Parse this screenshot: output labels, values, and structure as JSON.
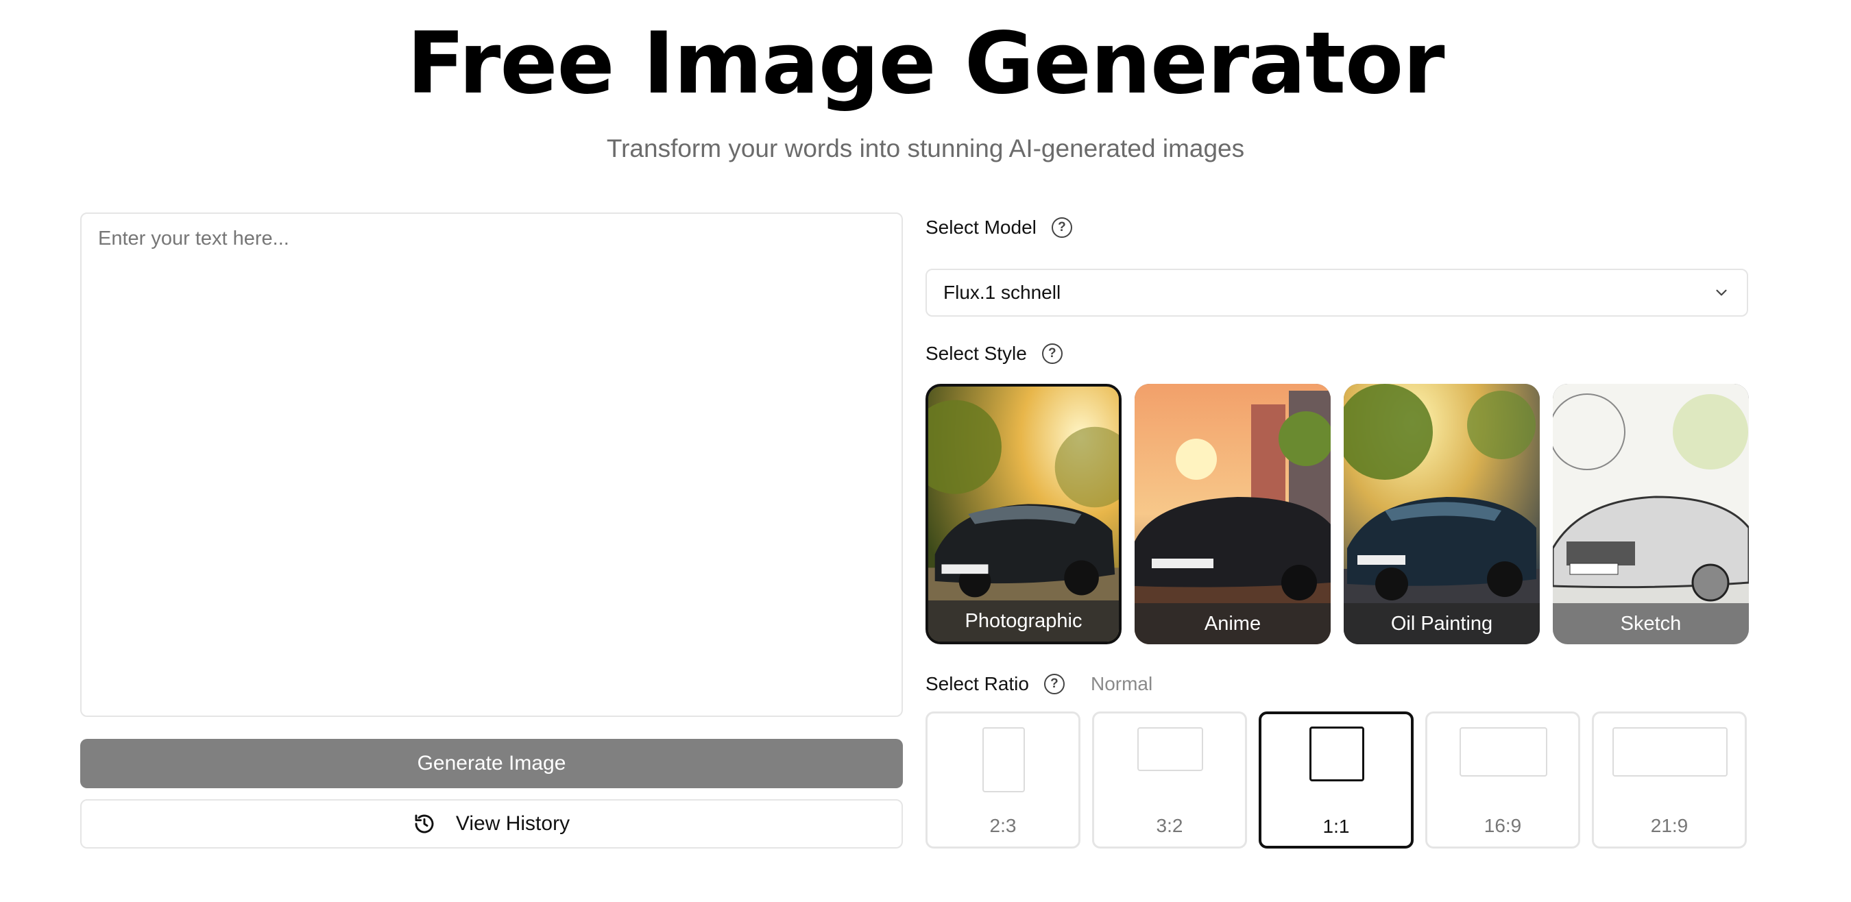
{
  "header": {
    "title": "Free Image Generator",
    "subtitle": "Transform your words into stunning AI-generated images"
  },
  "prompt": {
    "placeholder": "Enter your text here...",
    "value": ""
  },
  "buttons": {
    "generate_label": "Generate Image",
    "history_label": "View History",
    "history_icon": "history-icon"
  },
  "model": {
    "label": "Select Model",
    "help_icon": "help-icon",
    "selected": "Flux.1 schnell",
    "dropdown_icon": "chevron-down-icon"
  },
  "style": {
    "label": "Select Style",
    "help_icon": "help-icon",
    "selected": "Photographic",
    "options": [
      {
        "label": "Photographic"
      },
      {
        "label": "Anime"
      },
      {
        "label": "Oil Painting"
      },
      {
        "label": "Sketch"
      }
    ]
  },
  "ratio": {
    "label": "Select Ratio",
    "help_icon": "help-icon",
    "note": "Normal",
    "selected": "1:1",
    "options": [
      {
        "label": "2:3"
      },
      {
        "label": "3:2"
      },
      {
        "label": "1:1"
      },
      {
        "label": "16:9"
      },
      {
        "label": "21:9"
      }
    ]
  },
  "colors": {
    "primary_text": "#111111",
    "muted_text": "#6b6b6b",
    "button_disabled": "#808080",
    "border": "#e5e5e5"
  }
}
